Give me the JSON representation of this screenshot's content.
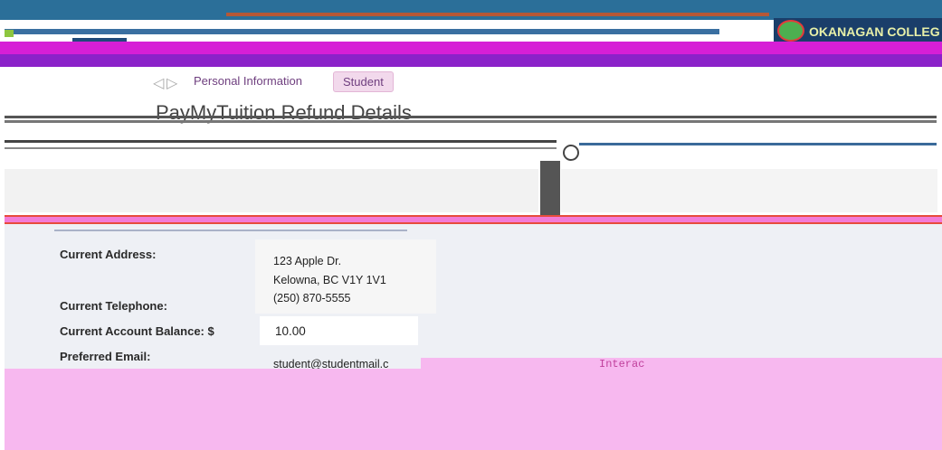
{
  "header": {
    "college_name": "OKANAGAN COLLEG"
  },
  "nav": {
    "prev_icon": "chevron-left-icon",
    "next_icon": "chevron-right-icon",
    "personal_label": "Personal Information",
    "student_label": "Student"
  },
  "page": {
    "title": "PayMyTuition Refund Details"
  },
  "form": {
    "address_label": "Current Address:",
    "address_line1": "123 Apple Dr.",
    "address_line2": "Kelowna, BC V1Y 1V1",
    "telephone_label": "Current Telephone:",
    "telephone_value": "(250) 870-5555",
    "balance_label": "Current Account Balance: $",
    "balance_value": "10.00",
    "email_label": "Preferred Email:",
    "email_value": "student@studentmail.c",
    "payment_method": "Interac"
  },
  "colors": {
    "brand_blue": "#2b6f99",
    "magenta": "#d61fd6",
    "purple": "#8b22c9",
    "student_tab_bg": "#f2d9ec"
  }
}
